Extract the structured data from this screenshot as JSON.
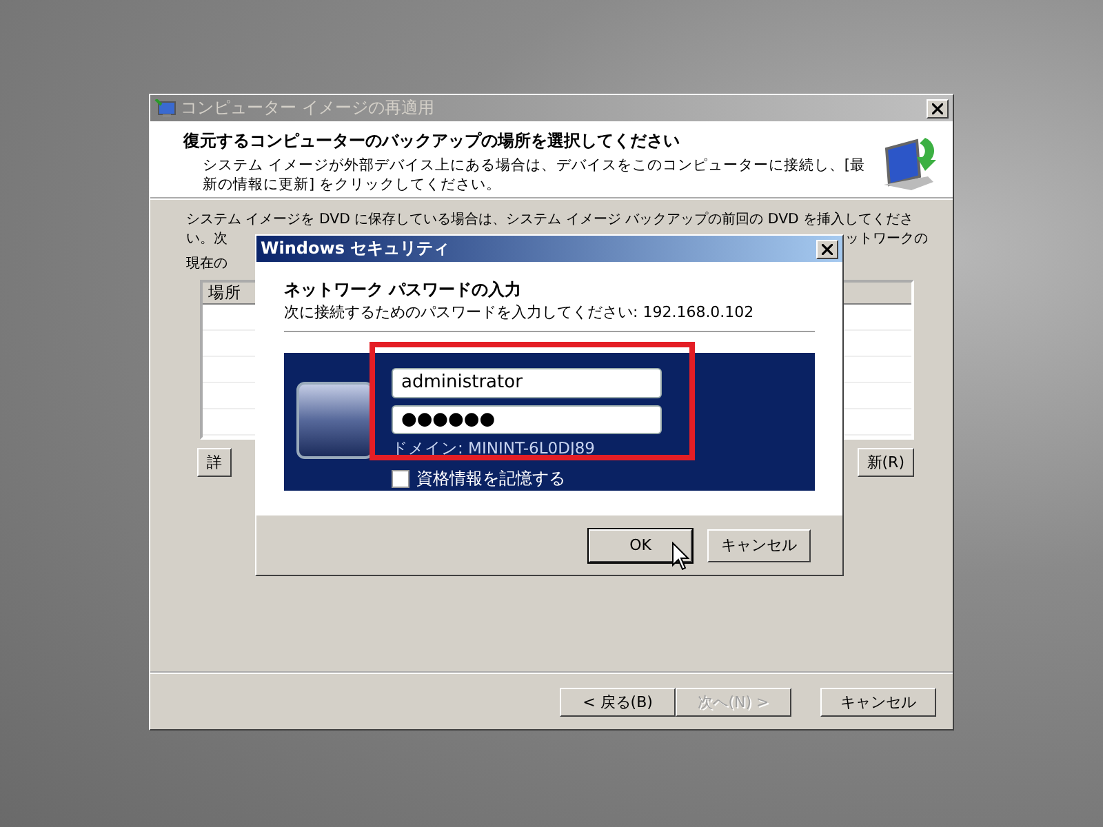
{
  "wizard": {
    "title": "コンピューター イメージの再適用",
    "heading": "復元するコンピューターのバックアップの場所を選択してください",
    "description": "システム イメージが外部デバイス上にある場合は、デバイスをこのコンピューターに接続し、[最新の情報に更新] をクリックしてください。",
    "body_line_1": "システム イメージを DVD に保存している場合は、システム イメージ バックアップの前回の DVD を挿入してくださ",
    "body_line_2_start": "い。次",
    "body_line_2_end": "ットワークの",
    "body_line_3": "現在の",
    "table": {
      "columns": [
        "場所"
      ]
    },
    "left_button": "詳",
    "right_button": "新(R)",
    "buttons": [
      {
        "label": "< 戻る(B)",
        "disabled": false
      },
      {
        "label": "次へ(N) >",
        "disabled": true
      },
      {
        "label": "キャンセル",
        "disabled": false
      }
    ]
  },
  "dialog": {
    "title": "Windows セキュリティ",
    "heading": "ネットワーク パスワードの入力",
    "subtitle": "次に接続するためのパスワードを入力してください: 192.168.0.102",
    "username": {
      "value": "administrator"
    },
    "password": {
      "value": "●●●●●●"
    },
    "domain": "ドメイン: MININT-6L0DJ89",
    "remember": {
      "label": "資格情報を記憶する",
      "checked": false
    },
    "buttons": [
      {
        "label": "OK",
        "default": true
      },
      {
        "label": "キャンセル",
        "default": false
      }
    ]
  }
}
